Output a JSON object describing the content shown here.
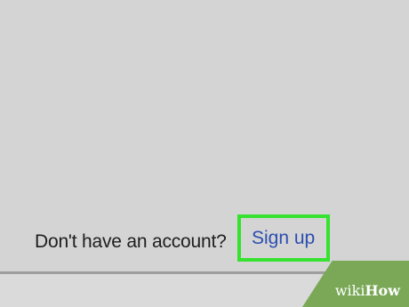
{
  "signup": {
    "prompt": "Don't have an account?",
    "link_label": "Sign up"
  },
  "watermark": {
    "brand_light": "wiki",
    "brand_bold": "How"
  },
  "colors": {
    "background": "#d4d4d4",
    "link": "#2b4eb0",
    "highlight_border": "#35e22f",
    "watermark_bg": "#7aa857"
  }
}
